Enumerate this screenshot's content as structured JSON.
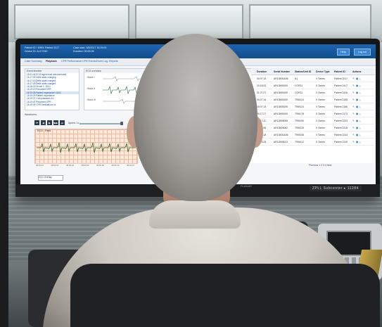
{
  "app": {
    "header": {
      "patient_label": "Patient ID / MRN: Patient 2417",
      "device_label": "Device ID: ALC7040",
      "case_label": "Case start: 3/8/2017 16:29:00",
      "duration_label": "Duration: 00:00:28",
      "btn_help": "Help",
      "btn_logout": "Log out"
    },
    "tabs": [
      "Case Summary",
      "Playback",
      "CPR Performance",
      "CPR Events",
      "Event Log",
      "Reports"
    ],
    "event_list": {
      "title": "Event timeline",
      "items": [
        "15:31:46 ECG signal lead disconnected",
        "16:17:09 Defib state charging",
        "16:17:19 Defib state charged",
        "16:17:28 Defib state charged",
        "16:18:23 Shock 1: 200J",
        "16:19:19 Resumed CPR",
        "16:19:28 Patient Impedance 120Ω",
        "16:19:29 Patient impedance",
        "16:19:37 Compressions 4x",
        "16:19:47 Resumed CPR",
        "16:19:49 CPR Ventilations 4x"
      ],
      "selected_index": 6
    },
    "ecg_preview": {
      "title": "ECG overview",
      "leads": [
        "Wave I",
        "Wave II",
        "Wave III"
      ]
    },
    "waveforms_label": "Waveforms",
    "controls": [
      "⏮",
      "◀",
      "▶",
      "▶▶",
      "⏭"
    ],
    "speed_label": "Speed: 1x",
    "strip": {
      "title": "ECG - Pads",
      "times": [
        "08:02:00",
        "08:02:02",
        "08:02:04",
        "08:02:06",
        "08:02:08",
        "08:02:10",
        "08:02:12"
      ]
    },
    "footer_select": "ECG Overlay",
    "table": {
      "headers": [
        "Duration",
        "Serial Number",
        "Station/Unit ID",
        "Device Type",
        "Patient ID",
        "Actions"
      ],
      "rows": [
        [
          "00:07:16",
          "AR13B04A06",
          "A1",
          "X Series",
          "Patient 2017"
        ],
        [
          "00:18:33",
          "AR13B05190",
          "COR21",
          "X Series",
          "Patient 2417"
        ],
        [
          "01:27:27",
          "AR13B05190",
          "COR21",
          "X Series",
          "Patient 2416"
        ],
        [
          "00:07:15",
          "AR13B05190",
          "TRM124",
          "X Series",
          "Patient 2155"
        ],
        [
          "00:07:15",
          "AR13B05190",
          "TRM124",
          "X Series",
          "Patient 2166"
        ],
        [
          "00:17:27",
          "AR13B05190",
          "TRM178",
          "X Series",
          "Patient 2173"
        ],
        [
          "00:17:11",
          "AR12B05095",
          "TRM190",
          "X Series",
          "Patient 2203"
        ],
        [
          "00:25:55",
          "AR13B05082",
          "TRM225",
          "X Series",
          "Patient 2218"
        ],
        [
          "00:27:18",
          "AR13B04A06",
          "TRM108",
          "X Series",
          "Patient 2244"
        ],
        [
          "00:05:28",
          "AR12B05013",
          "TRM412",
          "X Series",
          "Patient 2245"
        ]
      ],
      "pager": "Previous  1  2  3  4  Next"
    }
  },
  "monitor": {
    "model_label": "ZPLL Subcenter ▸ 11284",
    "brand_mark": "PLANAR"
  },
  "colors": {
    "header_blue": "#1c64b0",
    "grid_pink": "#f1b9a0",
    "ecg_trace": "#1e6a2e",
    "hair_gray": "#a4a19d"
  }
}
